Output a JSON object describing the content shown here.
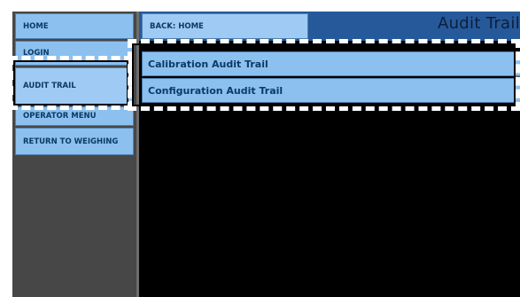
{
  "sidebar": {
    "items": [
      {
        "id": "home",
        "label": "HOME"
      },
      {
        "id": "login",
        "label": "LOGIN"
      },
      {
        "id": "audit-trail",
        "label": "AUDIT TRAIL"
      },
      {
        "id": "operator-menu",
        "label": "OPERATOR MENU"
      },
      {
        "id": "return-to-weighing",
        "label": "RETURN TO WEIGHING"
      }
    ],
    "active": "audit-trail"
  },
  "header": {
    "back_label": "BACK: HOME",
    "title": "Audit Trail"
  },
  "list": {
    "items": [
      {
        "label": "Calibration Audit Trail"
      },
      {
        "label": "Configuration Audit Trail"
      }
    ]
  },
  "colors": {
    "button_fill": "#8cc0ef",
    "button_text": "#0c3a66",
    "header_bar": "#26599a",
    "sidebar_bg": "#474747",
    "content_bg": "#000000"
  }
}
